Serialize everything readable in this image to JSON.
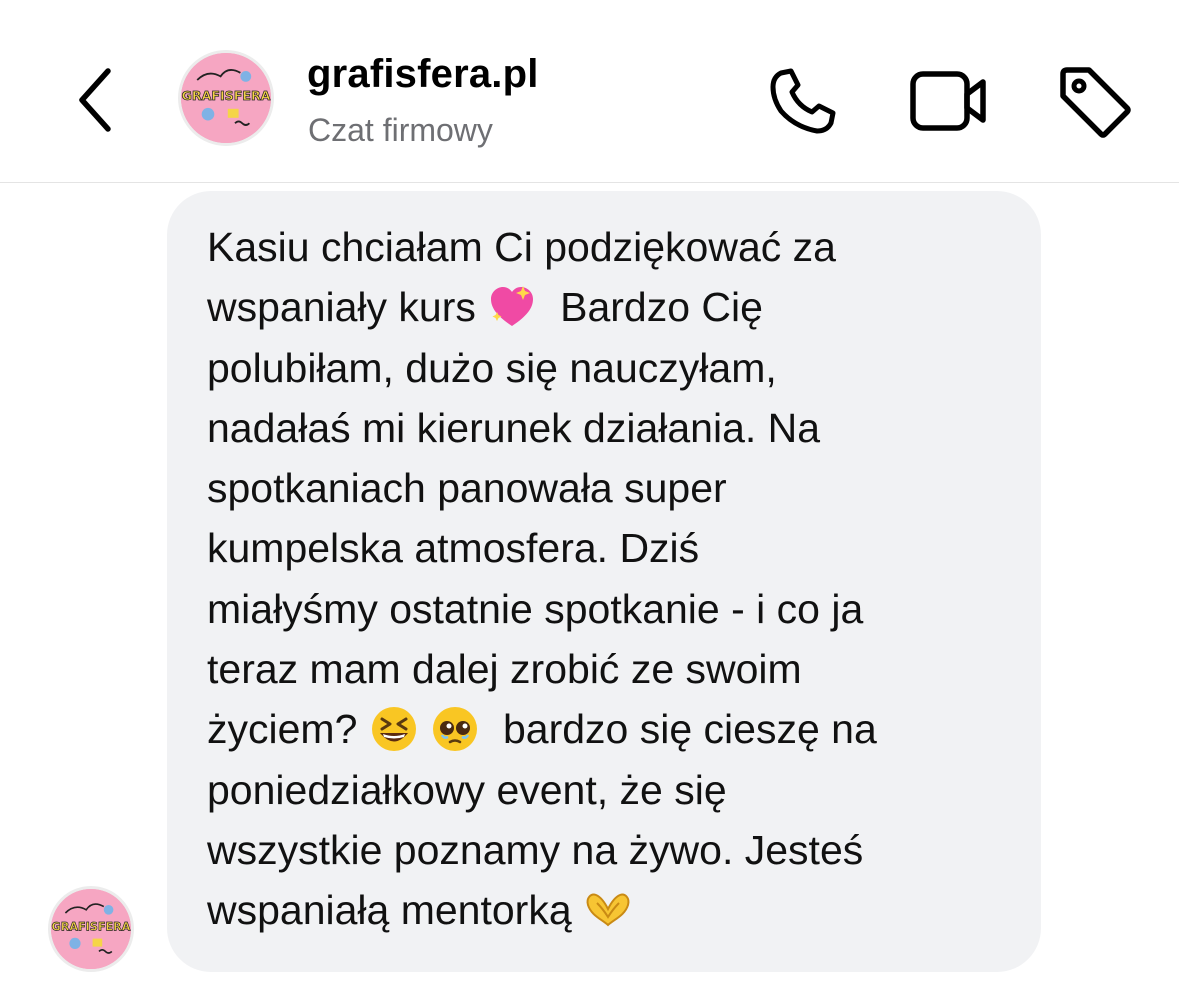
{
  "header": {
    "name": "grafisfera.pl",
    "subtitle": "Czat firmowy",
    "logo_text": "GRAFISFERA"
  },
  "icons": {
    "back": "chevron-left-icon",
    "call": "phone-icon",
    "video": "video-camera-icon",
    "tag": "tag-icon"
  },
  "message": {
    "segments": [
      "Kasiu chciałam Ci podziękować za",
      "wspaniały kurs",
      "Bardzo Cię",
      "polubiłam, dużo się nauczyłam,",
      "nadałaś mi kierunek działania. Na",
      "spotkaniach panowała super",
      "kumpelska atmosfera. Dziś",
      "miałyśmy ostatnie spotkanie - i co ja",
      "teraz mam dalej zrobić ze swoim",
      "życiem?",
      "bardzo się cieszę na",
      "poniedziałkowy event, że się",
      "wszystkie poznamy na żywo. Jesteś",
      "wspaniałą mentorką"
    ],
    "emojis": [
      "sparkling-heart",
      "grinning-squinting-face",
      "pleading-face",
      "heart-hands"
    ]
  },
  "colors": {
    "bubble": "#f1f2f4",
    "subtitle": "#6e6f73",
    "avatar_bg": "#f6a6c2"
  }
}
